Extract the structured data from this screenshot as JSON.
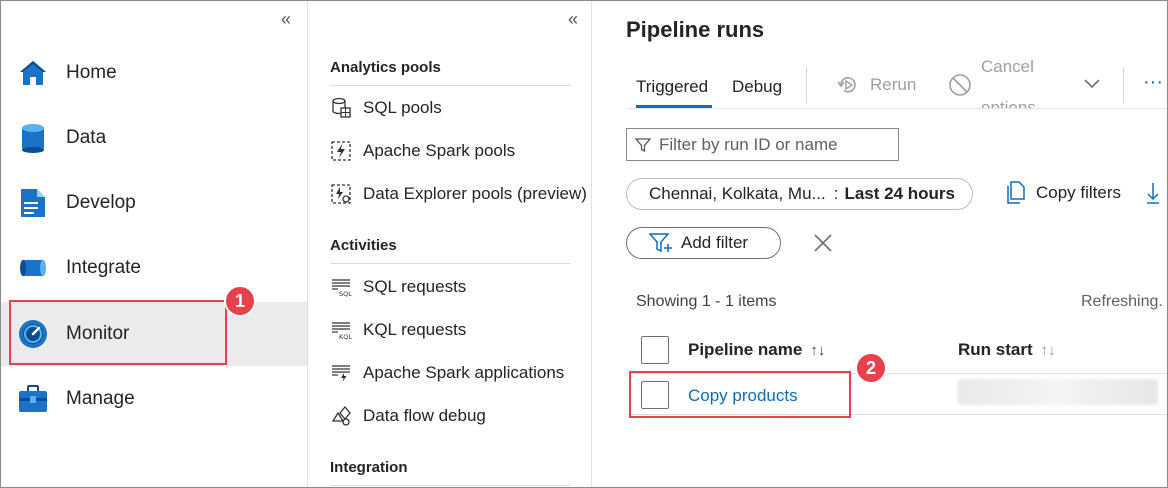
{
  "left_nav": {
    "collapse_icon": "double-chevron-left-icon",
    "items": [
      {
        "label": "Home",
        "icon": "home-icon"
      },
      {
        "label": "Data",
        "icon": "database-icon"
      },
      {
        "label": "Develop",
        "icon": "document-icon"
      },
      {
        "label": "Integrate",
        "icon": "pipeline-icon"
      },
      {
        "label": "Monitor",
        "icon": "gauge-icon",
        "selected": true
      },
      {
        "label": "Manage",
        "icon": "toolbox-icon"
      }
    ]
  },
  "hub": {
    "collapse_icon": "double-chevron-left-icon",
    "sections": [
      {
        "heading": "Analytics pools",
        "items": [
          {
            "label": "SQL pools",
            "icon": "sql-pool-icon"
          },
          {
            "label": "Apache Spark pools",
            "icon": "spark-pool-icon"
          },
          {
            "label": "Data Explorer pools (preview)",
            "icon": "data-explorer-pool-icon"
          }
        ]
      },
      {
        "heading": "Activities",
        "items": [
          {
            "label": "SQL requests",
            "icon": "sql-requests-icon"
          },
          {
            "label": "KQL requests",
            "icon": "kql-requests-icon"
          },
          {
            "label": "Apache Spark applications",
            "icon": "spark-applications-icon"
          },
          {
            "label": "Data flow debug",
            "icon": "data-flow-debug-icon"
          }
        ]
      },
      {
        "heading": "Integration",
        "items": []
      }
    ]
  },
  "main": {
    "title": "Pipeline runs",
    "tabs": [
      {
        "label": "Triggered",
        "active": true
      },
      {
        "label": "Debug",
        "active": false
      }
    ],
    "toolbar": {
      "rerun": "Rerun",
      "cancel_line1": "Cancel",
      "cancel_line2": "options",
      "more": "···"
    },
    "filter_placeholder": "Filter by run ID or name",
    "filter_pill": {
      "regions": "Chennai, Kolkata, Mu...",
      "separator": ":",
      "range": "Last 24 hours"
    },
    "copy_filters": "Copy filters",
    "add_filter": "Add filter",
    "showing": "Showing 1 - 1 items",
    "refreshing": "Refreshing.",
    "columns": [
      {
        "label": "Pipeline name",
        "sort": "↑↓"
      },
      {
        "label": "Run start",
        "sort": "↑↓"
      }
    ],
    "rows": [
      {
        "pipeline_name": "Copy products"
      }
    ]
  },
  "callouts": [
    "1",
    "2"
  ],
  "colors": {
    "accent": "#0f6cbd",
    "callout": "#e8414b",
    "selected_bg": "#ebebeb"
  }
}
